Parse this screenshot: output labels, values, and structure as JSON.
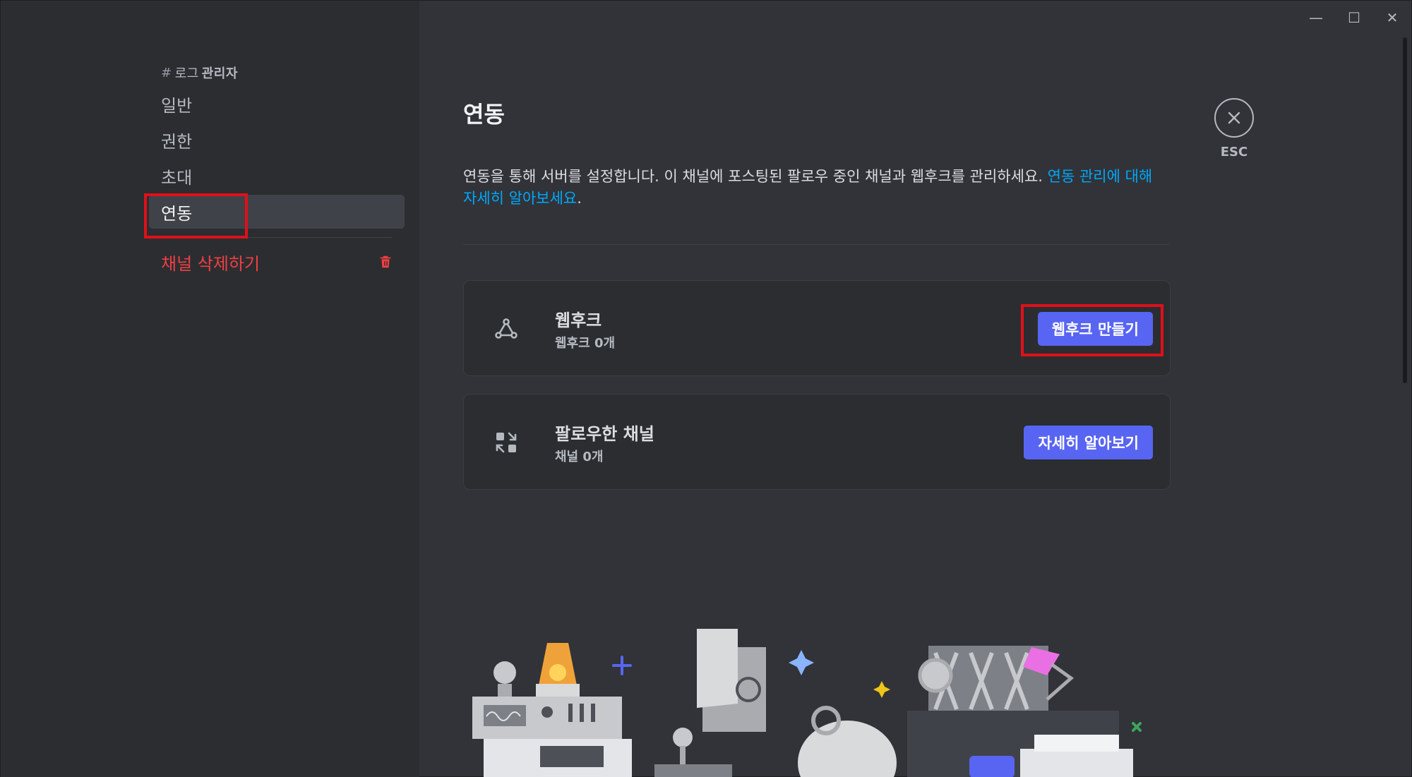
{
  "window": {
    "controls": [
      "—",
      "☐",
      "✕"
    ]
  },
  "sidebar": {
    "header_hash": "#",
    "header_channel": "로그",
    "header_suffix": "관리자",
    "items": [
      {
        "label": "일반",
        "active": false
      },
      {
        "label": "권한",
        "active": false
      },
      {
        "label": "초대",
        "active": false
      },
      {
        "label": "연동",
        "active": true
      }
    ],
    "delete_label": "채널 삭제하기"
  },
  "main": {
    "title": "연동",
    "description": "연동을 통해 서버를 설정합니다. 이 채널에 포스팅된 팔로우 중인 채널과 웹후크를 관리하세요. ",
    "description_link": "연동 관리에 대해 자세히 알아보세요",
    "description_end": ".",
    "cards": [
      {
        "title": "웹후크",
        "subtitle": "웹후크 0개",
        "button": "웹후크 만들기",
        "icon": "webhook-icon"
      },
      {
        "title": "팔로우한 채널",
        "subtitle": "채널 0개",
        "button": "자세히 알아보기",
        "icon": "followed-channels-icon"
      }
    ],
    "esc_label": "ESC"
  },
  "colors": {
    "accent": "#5865f2",
    "danger": "#f23f42",
    "link": "#00a8fc",
    "highlight": "#e0101a"
  }
}
